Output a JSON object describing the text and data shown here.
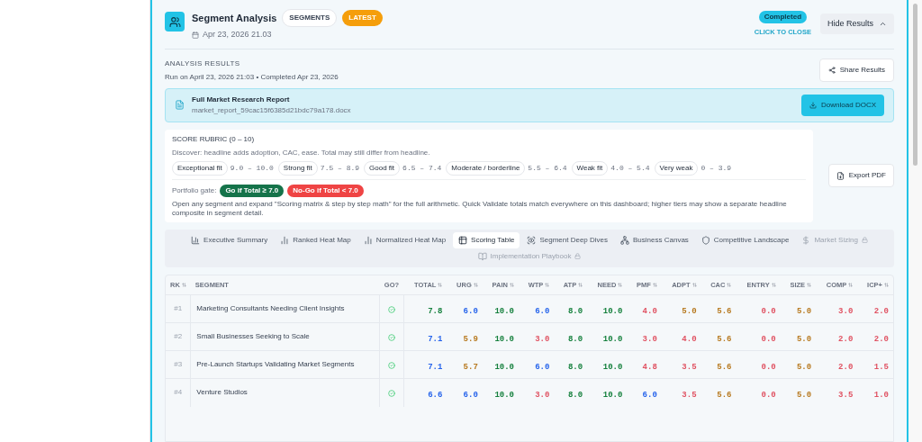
{
  "header": {
    "title": "Segment Analysis",
    "badges": [
      {
        "label": "SEGMENTS",
        "kind": "outline"
      },
      {
        "label": "LATEST",
        "kind": "accent"
      }
    ],
    "date": "Apr 23, 2026 21.03",
    "status": "Completed",
    "status_hint": "CLICK TO CLOSE",
    "toggle": "Hide Results"
  },
  "results": {
    "heading": "ANALYSIS RESULTS",
    "subtitle": "Run on April 23, 2026 21:03 • Completed Apr 23, 2026",
    "share": "Share Results"
  },
  "report": {
    "title": "Full Market Research Report",
    "file": "market_report_59cac15f6385d21bdc79a178.docx",
    "download": "Download DOCX"
  },
  "rubric": {
    "title": "SCORE RUBRIC (0 – 10)",
    "note": "Discover: headline adds adoption, CAC, ease. Total may still differ from headline.",
    "tiers": [
      {
        "label": "Exceptional fit",
        "range": "9.0 – 10.0"
      },
      {
        "label": "Strong fit",
        "range": "7.5 – 8.9"
      },
      {
        "label": "Good fit",
        "range": "6.5 – 7.4"
      },
      {
        "label": "Moderate / borderline",
        "range": "5.5 – 6.4"
      },
      {
        "label": "Weak fit",
        "range": "4.0 – 5.4"
      },
      {
        "label": "Very weak",
        "range": "0 – 3.9"
      }
    ],
    "gate_label": "Portfolio gate:",
    "gates": [
      {
        "label": "Go if Total ≥ 7.0",
        "kind": "go"
      },
      {
        "label": "No-Go if Total < 7.0",
        "kind": "nogo"
      }
    ],
    "footnote": "Open any segment and expand \"Scoring matrix & step by step math\" for the full arithmetic. Quick Validate totals match everywhere on this dashboard; higher tiers may show a separate headline composite in segment detail."
  },
  "export": "Export PDF",
  "tabs": [
    {
      "label": "Executive Summary",
      "selected": false,
      "locked": false
    },
    {
      "label": "Ranked Heat Map",
      "selected": false,
      "locked": false
    },
    {
      "label": "Normalized Heat Map",
      "selected": false,
      "locked": false
    },
    {
      "label": "Scoring Table",
      "selected": true,
      "locked": false
    },
    {
      "label": "Segment Deep Dives",
      "selected": false,
      "locked": false
    },
    {
      "label": "Business Canvas",
      "selected": false,
      "locked": false
    },
    {
      "label": "Competitive Landscape",
      "selected": false,
      "locked": false
    },
    {
      "label": "Market Sizing",
      "selected": false,
      "locked": true
    },
    {
      "label": "Implementation Playbook",
      "selected": false,
      "locked": true
    }
  ],
  "table": {
    "columns": [
      {
        "label": "RK",
        "sortable": true
      },
      {
        "label": "SEGMENT",
        "sortable": false
      },
      {
        "label": "GO?",
        "sortable": false
      },
      {
        "label": "TOTAL",
        "sortable": true
      },
      {
        "label": "URG",
        "sortable": true
      },
      {
        "label": "PAIN",
        "sortable": true
      },
      {
        "label": "WTP",
        "sortable": true
      },
      {
        "label": "ATP",
        "sortable": true
      },
      {
        "label": "NEED",
        "sortable": true
      },
      {
        "label": "PMF",
        "sortable": true
      },
      {
        "label": "ADPT",
        "sortable": true
      },
      {
        "label": "CAC",
        "sortable": true
      },
      {
        "label": "ENTRY",
        "sortable": true
      },
      {
        "label": "SIZE",
        "sortable": true
      },
      {
        "label": "COMP",
        "sortable": true
      },
      {
        "label": "ICP+",
        "sortable": true
      }
    ],
    "rows": [
      {
        "rank": "#1",
        "segment": "Marketing Consultants Needing Client Insights",
        "go": true,
        "scores": [
          {
            "v": "7.8",
            "color": "#15803d"
          },
          {
            "v": "6.0",
            "color": "#2563eb"
          },
          {
            "v": "10.0",
            "color": "#15803d"
          },
          {
            "v": "6.0",
            "color": "#2563eb"
          },
          {
            "v": "8.0",
            "color": "#15803d"
          },
          {
            "v": "10.0",
            "color": "#15803d"
          },
          {
            "v": "4.0",
            "color": "#e05262"
          },
          {
            "v": "5.0",
            "color": "#b7791f"
          },
          {
            "v": "5.6",
            "color": "#b7791f"
          },
          {
            "v": "0.0",
            "color": "#e05262"
          },
          {
            "v": "5.0",
            "color": "#b7791f"
          },
          {
            "v": "3.0",
            "color": "#e05262"
          },
          {
            "v": "2.0",
            "color": "#e05262"
          }
        ]
      },
      {
        "rank": "#2",
        "segment": "Small Businesses Seeking to Scale",
        "go": true,
        "scores": [
          {
            "v": "7.1",
            "color": "#2563eb"
          },
          {
            "v": "5.9",
            "color": "#b7791f"
          },
          {
            "v": "10.0",
            "color": "#15803d"
          },
          {
            "v": "3.0",
            "color": "#e05262"
          },
          {
            "v": "8.0",
            "color": "#15803d"
          },
          {
            "v": "10.0",
            "color": "#15803d"
          },
          {
            "v": "3.0",
            "color": "#e05262"
          },
          {
            "v": "4.0",
            "color": "#e05262"
          },
          {
            "v": "5.6",
            "color": "#b7791f"
          },
          {
            "v": "0.0",
            "color": "#e05262"
          },
          {
            "v": "5.0",
            "color": "#b7791f"
          },
          {
            "v": "2.0",
            "color": "#e05262"
          },
          {
            "v": "2.0",
            "color": "#e05262"
          }
        ]
      },
      {
        "rank": "#3",
        "segment": "Pre-Launch Startups Validating Market Segments",
        "go": true,
        "scores": [
          {
            "v": "7.1",
            "color": "#2563eb"
          },
          {
            "v": "5.7",
            "color": "#b7791f"
          },
          {
            "v": "10.0",
            "color": "#15803d"
          },
          {
            "v": "6.0",
            "color": "#2563eb"
          },
          {
            "v": "8.0",
            "color": "#15803d"
          },
          {
            "v": "10.0",
            "color": "#15803d"
          },
          {
            "v": "4.8",
            "color": "#e05262"
          },
          {
            "v": "3.5",
            "color": "#e05262"
          },
          {
            "v": "5.6",
            "color": "#b7791f"
          },
          {
            "v": "0.0",
            "color": "#e05262"
          },
          {
            "v": "5.0",
            "color": "#b7791f"
          },
          {
            "v": "2.0",
            "color": "#e05262"
          },
          {
            "v": "1.5",
            "color": "#e05262"
          }
        ]
      },
      {
        "rank": "#4",
        "segment": "Venture Studios",
        "go": true,
        "scores": [
          {
            "v": "6.6",
            "color": "#2563eb"
          },
          {
            "v": "6.0",
            "color": "#2563eb"
          },
          {
            "v": "10.0",
            "color": "#15803d"
          },
          {
            "v": "3.0",
            "color": "#e05262"
          },
          {
            "v": "8.0",
            "color": "#15803d"
          },
          {
            "v": "10.0",
            "color": "#15803d"
          },
          {
            "v": "6.0",
            "color": "#2563eb"
          },
          {
            "v": "3.5",
            "color": "#e05262"
          },
          {
            "v": "5.6",
            "color": "#b7791f"
          },
          {
            "v": "0.0",
            "color": "#e05262"
          },
          {
            "v": "5.0",
            "color": "#b7791f"
          },
          {
            "v": "3.5",
            "color": "#e05262"
          },
          {
            "v": "1.0",
            "color": "#e05262"
          }
        ]
      }
    ]
  }
}
